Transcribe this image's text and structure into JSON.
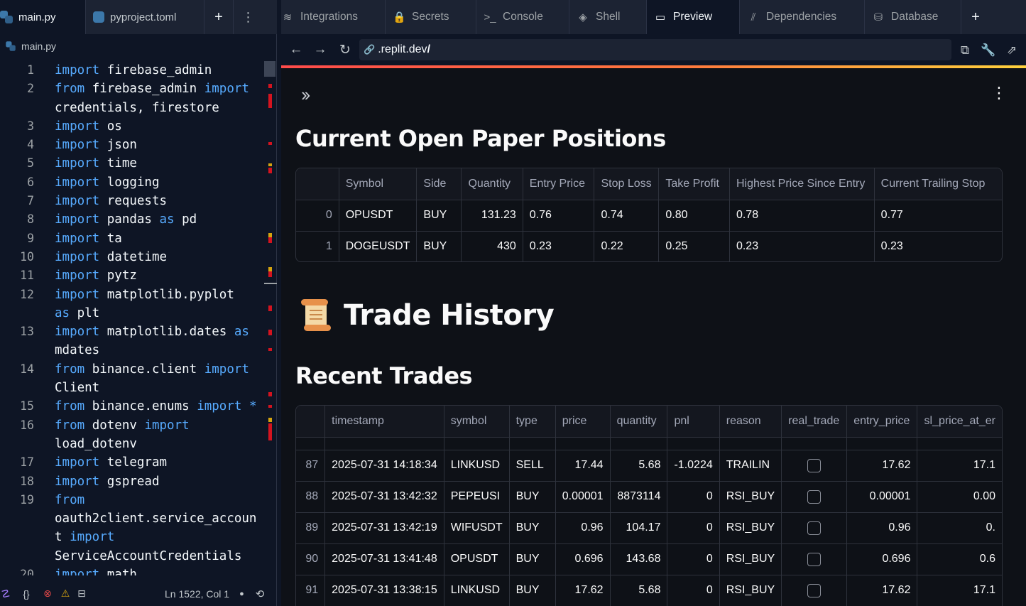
{
  "editor": {
    "tabs": [
      {
        "label": "main.py"
      },
      {
        "label": "pyproject.toml"
      }
    ],
    "add_label": "+",
    "menu_label": "⋮",
    "breadcrumb": "main.py",
    "code_lines": [
      {
        "n": "1",
        "parts": [
          [
            "kw",
            "import"
          ],
          [
            "t",
            " firebase_admin"
          ]
        ]
      },
      {
        "n": "2",
        "parts": [
          [
            "kw",
            "from"
          ],
          [
            "t",
            " firebase_admin "
          ],
          [
            "kw",
            "import"
          ]
        ]
      },
      {
        "n": "",
        "parts": [
          [
            "t",
            "credentials, firestore"
          ]
        ]
      },
      {
        "n": "3",
        "parts": [
          [
            "kw",
            "import"
          ],
          [
            "t",
            " os"
          ]
        ]
      },
      {
        "n": "4",
        "parts": [
          [
            "kw",
            "import"
          ],
          [
            "t",
            " json"
          ]
        ]
      },
      {
        "n": "5",
        "parts": [
          [
            "kw",
            "import"
          ],
          [
            "t",
            " time"
          ]
        ]
      },
      {
        "n": "6",
        "parts": [
          [
            "kw",
            "import"
          ],
          [
            "t",
            " logging"
          ]
        ]
      },
      {
        "n": "7",
        "parts": [
          [
            "kw",
            "import"
          ],
          [
            "t",
            " requests"
          ]
        ]
      },
      {
        "n": "8",
        "parts": [
          [
            "kw",
            "import"
          ],
          [
            "t",
            " pandas "
          ],
          [
            "kw",
            "as"
          ],
          [
            "t",
            " pd"
          ]
        ]
      },
      {
        "n": "9",
        "parts": [
          [
            "kw",
            "import"
          ],
          [
            "t",
            " ta"
          ]
        ]
      },
      {
        "n": "10",
        "parts": [
          [
            "kw",
            "import"
          ],
          [
            "t",
            " datetime"
          ]
        ]
      },
      {
        "n": "11",
        "parts": [
          [
            "kw",
            "import"
          ],
          [
            "t",
            " pytz"
          ]
        ]
      },
      {
        "n": "12",
        "parts": [
          [
            "kw",
            "import"
          ],
          [
            "t",
            " matplotlib.pyplot"
          ]
        ]
      },
      {
        "n": "",
        "parts": [
          [
            "kw",
            "as"
          ],
          [
            "t",
            " plt"
          ]
        ]
      },
      {
        "n": "13",
        "parts": [
          [
            "kw",
            "import"
          ],
          [
            "t",
            " matplotlib.dates "
          ],
          [
            "kw",
            "as"
          ]
        ]
      },
      {
        "n": "",
        "parts": [
          [
            "t",
            "mdates"
          ]
        ]
      },
      {
        "n": "14",
        "parts": [
          [
            "kw",
            "from"
          ],
          [
            "t",
            " binance.client "
          ],
          [
            "kw",
            "import"
          ]
        ]
      },
      {
        "n": "",
        "parts": [
          [
            "t",
            "Client"
          ]
        ]
      },
      {
        "n": "15",
        "parts": [
          [
            "kw",
            "from"
          ],
          [
            "t",
            " binance.enums "
          ],
          [
            "kw",
            "import"
          ],
          [
            "t",
            " "
          ],
          [
            "kw",
            "*"
          ]
        ]
      },
      {
        "n": "16",
        "parts": [
          [
            "kw",
            "from"
          ],
          [
            "t",
            " dotenv "
          ],
          [
            "kw",
            "import"
          ]
        ]
      },
      {
        "n": "",
        "parts": [
          [
            "t",
            "load_dotenv"
          ]
        ]
      },
      {
        "n": "17",
        "parts": [
          [
            "kw",
            "import"
          ],
          [
            "t",
            " telegram"
          ]
        ]
      },
      {
        "n": "18",
        "parts": [
          [
            "kw",
            "import"
          ],
          [
            "t",
            " gspread"
          ]
        ]
      },
      {
        "n": "19",
        "parts": [
          [
            "kw",
            "from"
          ]
        ]
      },
      {
        "n": "",
        "parts": [
          [
            "t",
            "oauth2client.service_accoun"
          ]
        ]
      },
      {
        "n": "",
        "parts": [
          [
            "t",
            "t "
          ],
          [
            "kw",
            "import"
          ]
        ]
      },
      {
        "n": "",
        "parts": [
          [
            "t",
            "ServiceAccountCredentials"
          ]
        ]
      },
      {
        "n": "20",
        "parts": [
          [
            "kw",
            "import"
          ],
          [
            "t",
            " math"
          ]
        ]
      }
    ],
    "status": {
      "position": "Ln 1522, Col 1",
      "braces": "{}",
      "error_icon": "error-icon",
      "warning_icon": "warning-icon"
    }
  },
  "workspace_tabs": [
    {
      "label": "Integrations",
      "icon": "integrations-icon",
      "glyph": "≋"
    },
    {
      "label": "Secrets",
      "icon": "lock-icon",
      "glyph": "🔒"
    },
    {
      "label": "Console",
      "icon": "console-icon",
      "glyph": ">_"
    },
    {
      "label": "Shell",
      "icon": "shell-icon",
      "glyph": "◈"
    },
    {
      "label": "Preview",
      "icon": "monitor-icon",
      "glyph": "▭",
      "active": true
    },
    {
      "label": "Dependencies",
      "icon": "dependencies-icon",
      "glyph": "⫽"
    },
    {
      "label": "Database",
      "icon": "database-icon",
      "glyph": "⛁"
    }
  ],
  "browser": {
    "url": ".replit.dev/",
    "url_prefix": ".replit.dev",
    "url_suffix": "/"
  },
  "app": {
    "positions_title": "Current Open Paper Positions",
    "history_title": "Trade History",
    "recent_title": "Recent Trades",
    "positions_table": {
      "columns": [
        "",
        "Symbol",
        "Side",
        "Quantity",
        "Entry Price",
        "Stop Loss",
        "Take Profit",
        "Highest Price Since Entry",
        "Current Trailing Stop"
      ],
      "rows": [
        [
          "0",
          "OPUSDT",
          "BUY",
          "131.23",
          "0.76",
          "0.74",
          "0.80",
          "0.78",
          "0.77"
        ],
        [
          "1",
          "DOGEUSDT",
          "BUY",
          "430",
          "0.23",
          "0.22",
          "0.25",
          "0.23",
          "0.23"
        ]
      ]
    },
    "trades_table": {
      "columns": [
        "",
        "timestamp",
        "symbol",
        "type",
        "price",
        "quantity",
        "pnl",
        "reason",
        "real_trade",
        "entry_price",
        "sl_price_at_er"
      ],
      "rows": [
        [
          "87",
          "2025-07-31 14:18:34",
          "LINKUSD",
          "SELL",
          "17.44",
          "5.68",
          "-1.0224",
          "TRAILIN",
          false,
          "17.62",
          "17.1"
        ],
        [
          "88",
          "2025-07-31 13:42:32",
          "PEPEUSI",
          "BUY",
          "0.00001",
          "8873114",
          "0",
          "RSI_BUY",
          false,
          "0.00001",
          "0.00"
        ],
        [
          "89",
          "2025-07-31 13:42:19",
          "WIFUSDT",
          "BUY",
          "0.96",
          "104.17",
          "0",
          "RSI_BUY",
          false,
          "0.96",
          "0."
        ],
        [
          "90",
          "2025-07-31 13:41:48",
          "OPUSDT",
          "BUY",
          "0.696",
          "143.68",
          "0",
          "RSI_BUY",
          false,
          "0.696",
          "0.6"
        ],
        [
          "91",
          "2025-07-31 13:38:15",
          "LINKUSD",
          "BUY",
          "17.62",
          "5.68",
          "0",
          "RSI_BUY",
          false,
          "17.62",
          "17.1"
        ]
      ]
    }
  },
  "colors": {
    "keyword": "#57abff",
    "accent_gradient_start": "#ff4b4b",
    "accent_gradient_end": "#ffd23d",
    "app_bg": "#0e1117",
    "ide_bg": "#0e1525"
  }
}
